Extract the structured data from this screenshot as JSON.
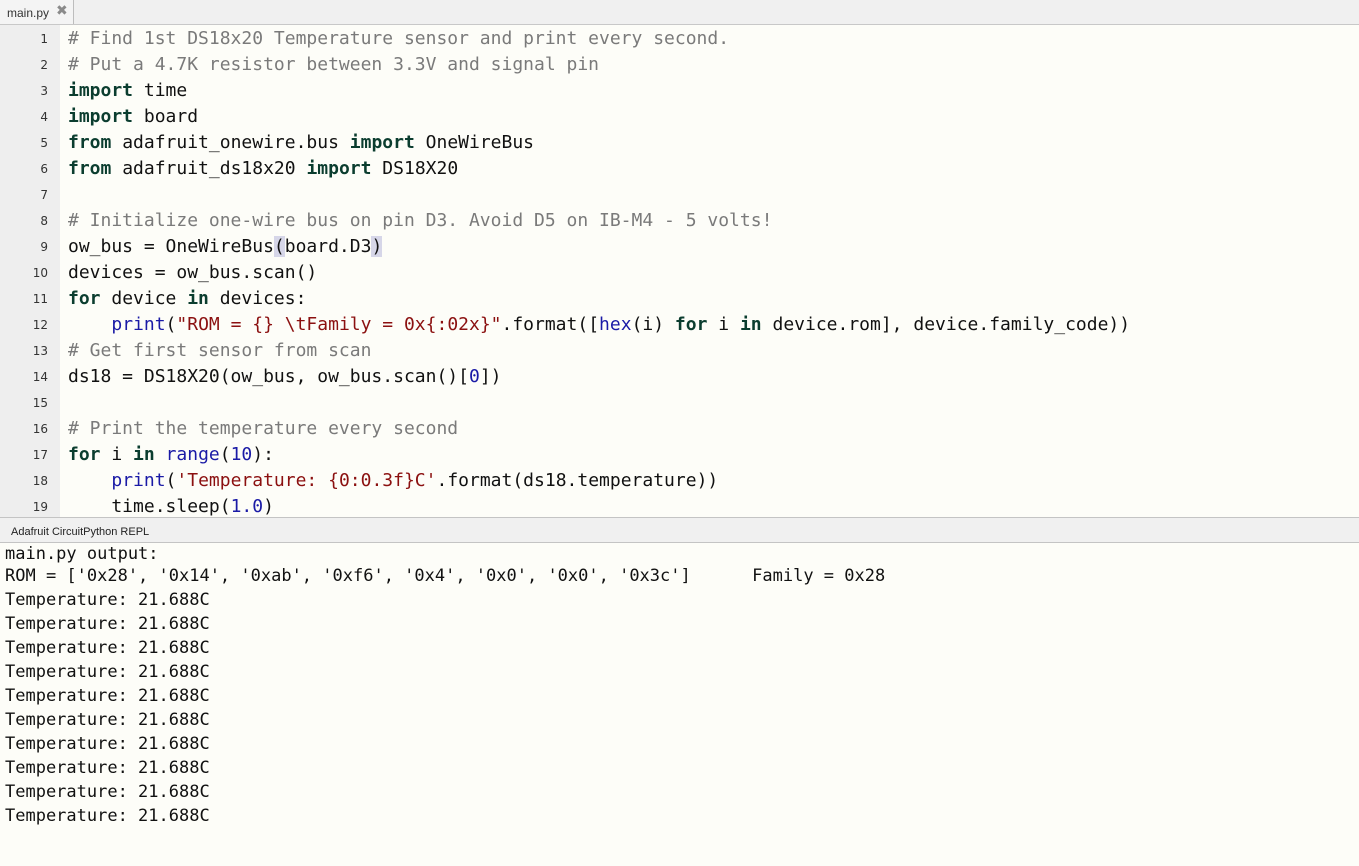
{
  "tab": {
    "label": "main.py",
    "close_glyph": "✖"
  },
  "code_lines": [
    {
      "n": "1",
      "segments": [
        {
          "t": "# Find 1st DS18x20 Temperature sensor and print every second.",
          "c": "comment"
        }
      ]
    },
    {
      "n": "2",
      "segments": [
        {
          "t": "# Put a 4.7K resistor between 3.3V and signal pin",
          "c": "comment"
        }
      ]
    },
    {
      "n": "3",
      "segments": [
        {
          "t": "import",
          "c": "kw"
        },
        {
          "t": " time",
          "c": ""
        }
      ]
    },
    {
      "n": "4",
      "segments": [
        {
          "t": "import",
          "c": "kw"
        },
        {
          "t": " board",
          "c": ""
        }
      ]
    },
    {
      "n": "5",
      "segments": [
        {
          "t": "from",
          "c": "kw"
        },
        {
          "t": " adafruit_onewire.bus ",
          "c": ""
        },
        {
          "t": "import",
          "c": "kw"
        },
        {
          "t": " OneWireBus",
          "c": ""
        }
      ]
    },
    {
      "n": "6",
      "segments": [
        {
          "t": "from",
          "c": "kw"
        },
        {
          "t": " adafruit_ds18x20 ",
          "c": ""
        },
        {
          "t": "import",
          "c": "kw"
        },
        {
          "t": " DS18X20",
          "c": ""
        }
      ]
    },
    {
      "n": "7",
      "segments": []
    },
    {
      "n": "8",
      "segments": [
        {
          "t": "# Initialize one-wire bus on pin D3. Avoid D5 on IB-M4 - 5 volts!",
          "c": "comment"
        }
      ]
    },
    {
      "n": "9",
      "segments": [
        {
          "t": "ow_bus = OneWireBus",
          "c": ""
        },
        {
          "t": "(",
          "c": "paren-hl"
        },
        {
          "t": "board.D3",
          "c": ""
        },
        {
          "t": ")",
          "c": "paren-hl"
        }
      ]
    },
    {
      "n": "10",
      "segments": [
        {
          "t": "devices = ow_bus.scan()",
          "c": ""
        }
      ]
    },
    {
      "n": "11",
      "segments": [
        {
          "t": "for",
          "c": "kw"
        },
        {
          "t": " device ",
          "c": ""
        },
        {
          "t": "in",
          "c": "kw"
        },
        {
          "t": " devices:",
          "c": ""
        }
      ]
    },
    {
      "n": "12",
      "segments": [
        {
          "t": "    ",
          "c": ""
        },
        {
          "t": "print",
          "c": "builtin"
        },
        {
          "t": "(",
          "c": ""
        },
        {
          "t": "\"ROM = {} \\tFamily = 0x{:02x}\"",
          "c": "string"
        },
        {
          "t": ".format([",
          "c": ""
        },
        {
          "t": "hex",
          "c": "builtin"
        },
        {
          "t": "(i) ",
          "c": ""
        },
        {
          "t": "for",
          "c": "kw"
        },
        {
          "t": " i ",
          "c": ""
        },
        {
          "t": "in",
          "c": "kw"
        },
        {
          "t": " device.rom], device.family_code))",
          "c": ""
        }
      ]
    },
    {
      "n": "13",
      "segments": [
        {
          "t": "# Get first sensor from scan",
          "c": "comment"
        }
      ]
    },
    {
      "n": "14",
      "segments": [
        {
          "t": "ds18 = DS18X20(ow_bus, ow_bus.scan()[",
          "c": ""
        },
        {
          "t": "0",
          "c": "num"
        },
        {
          "t": "])",
          "c": ""
        }
      ]
    },
    {
      "n": "15",
      "segments": []
    },
    {
      "n": "16",
      "segments": [
        {
          "t": "# Print the temperature every second",
          "c": "comment"
        }
      ]
    },
    {
      "n": "17",
      "segments": [
        {
          "t": "for",
          "c": "kw"
        },
        {
          "t": " i ",
          "c": ""
        },
        {
          "t": "in",
          "c": "kw"
        },
        {
          "t": " ",
          "c": ""
        },
        {
          "t": "range",
          "c": "builtin"
        },
        {
          "t": "(",
          "c": ""
        },
        {
          "t": "10",
          "c": "num"
        },
        {
          "t": "):",
          "c": ""
        }
      ]
    },
    {
      "n": "18",
      "segments": [
        {
          "t": "    ",
          "c": ""
        },
        {
          "t": "print",
          "c": "builtin"
        },
        {
          "t": "(",
          "c": ""
        },
        {
          "t": "'Temperature: {0:0.3f}C'",
          "c": "string"
        },
        {
          "t": ".format(ds18.temperature))",
          "c": ""
        }
      ]
    },
    {
      "n": "19",
      "segments": [
        {
          "t": "    time.sleep(",
          "c": ""
        },
        {
          "t": "1.0",
          "c": "num"
        },
        {
          "t": ")",
          "c": ""
        }
      ]
    }
  ],
  "repl": {
    "title": "Adafruit CircuitPython REPL",
    "output_lines": [
      "main.py output:",
      "ROM = ['0x28', '0x14', '0xab', '0xf6', '0x4', '0x0', '0x0', '0x3c']      Family = 0x28",
      "Temperature: 21.688C",
      "Temperature: 21.688C",
      "Temperature: 21.688C",
      "Temperature: 21.688C",
      "Temperature: 21.688C",
      "Temperature: 21.688C",
      "Temperature: 21.688C",
      "Temperature: 21.688C",
      "Temperature: 21.688C",
      "Temperature: 21.688C"
    ]
  },
  "colors": {
    "comment": "#7a7a7a",
    "keyword": "#0b3d2f",
    "builtin": "#1a1aa6",
    "string": "#8b1010",
    "background": "#fdfdf8",
    "gutter": "#eeeeee"
  }
}
